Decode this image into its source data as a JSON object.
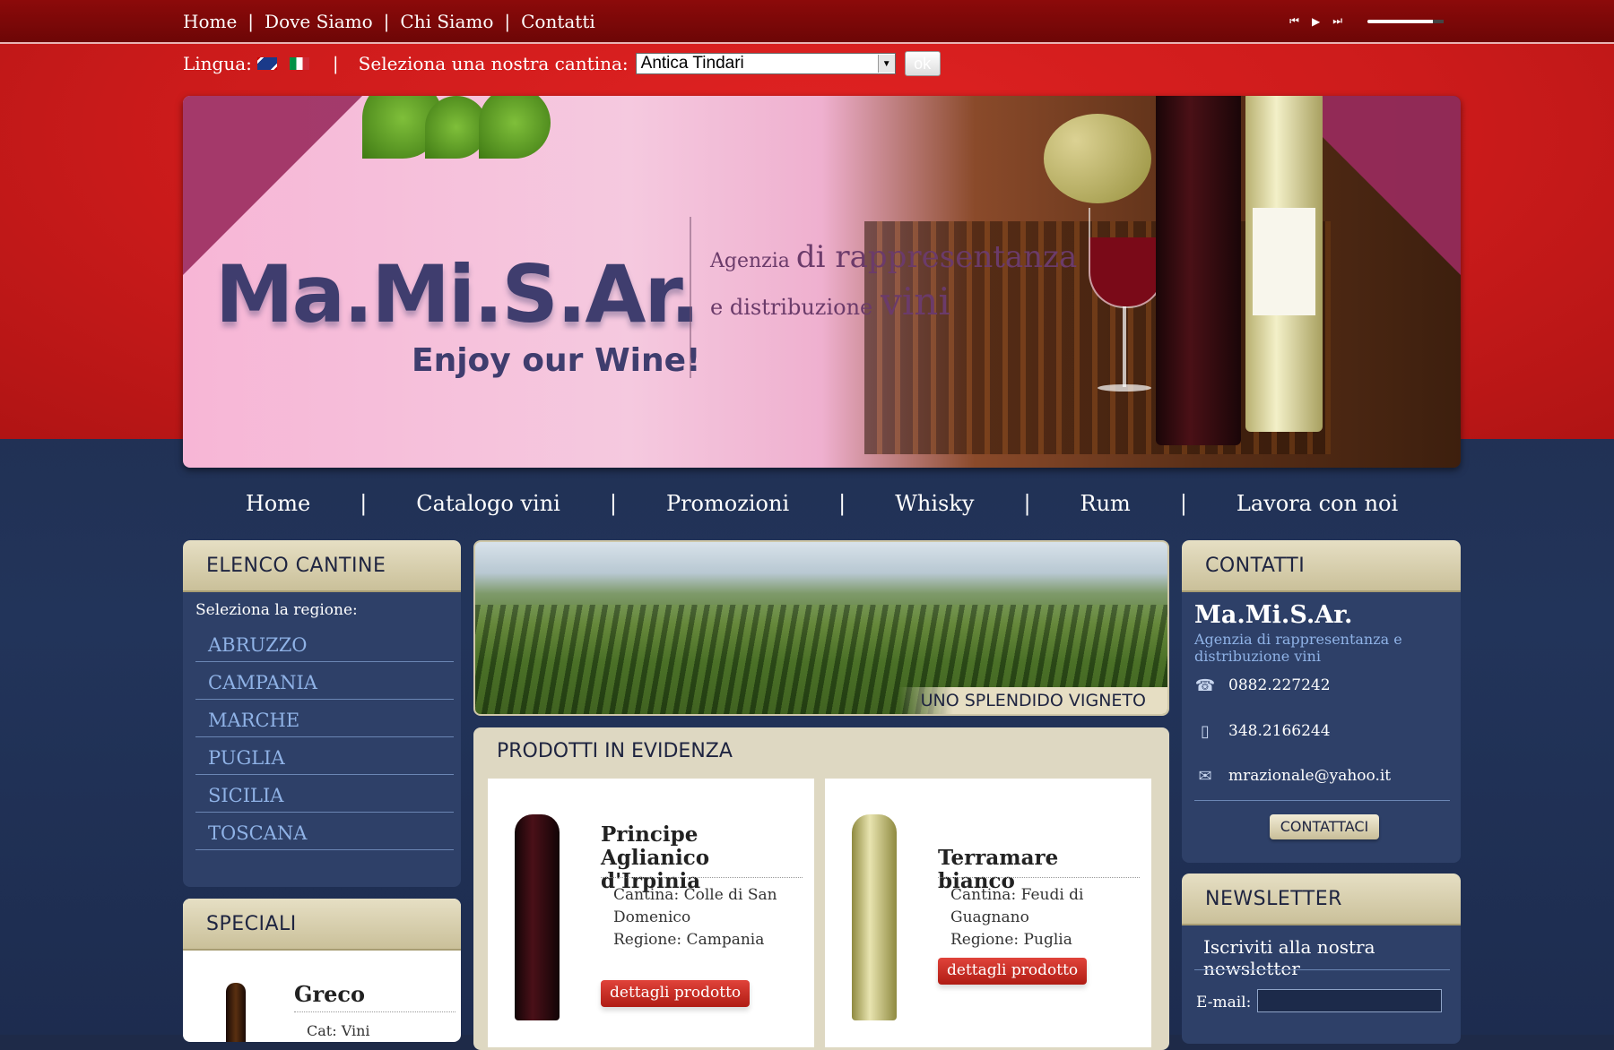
{
  "topnav": {
    "items": [
      "Home",
      "Dove Siamo",
      "Chi Siamo",
      "Contatti"
    ]
  },
  "lang": {
    "label": "Lingua:",
    "cantina_label": "Seleziona una nostra cantina:",
    "cantina_selected": "Antica Tindari",
    "ok_label": "ok"
  },
  "banner": {
    "logo": "Ma.Mi.S.Ar.",
    "slogan": "Enjoy our Wine!",
    "tagline1_small": "Agenzia",
    "tagline1_big": "di rappresentanza",
    "tagline2_small": "e distribuzione",
    "tagline2_big": "vini"
  },
  "mainnav": {
    "items": [
      "Home",
      "Catalogo vini",
      "Promozioni",
      "Whisky",
      "Rum",
      "Lavora con noi"
    ]
  },
  "cantine": {
    "title": "ELENCO CANTINE",
    "hint": "Seleziona la regione:",
    "regions": [
      "ABRUZZO",
      "CAMPANIA",
      "MARCHE",
      "PUGLIA",
      "SICILIA",
      "TOSCANA"
    ]
  },
  "speciali": {
    "title": "SPECIALI",
    "item_name": "Greco",
    "item_meta": "Cat: Vini"
  },
  "vineyard": {
    "caption": "UNO SPLENDIDO VIGNETO"
  },
  "products": {
    "title": "PRODOTTI IN EVIDENZA",
    "items": [
      {
        "name": "Principe Aglianico d'Irpinia",
        "cantina": "Cantina: Colle di San Domenico",
        "regione": "Regione: Campania",
        "button": "dettagli prodotto"
      },
      {
        "name": "Terramare bianco",
        "cantina": "Cantina: Feudi di Guagnano",
        "regione": "Regione: Puglia",
        "button": "dettagli prodotto"
      }
    ]
  },
  "contatti": {
    "title": "CONTATTI",
    "name": "Ma.Mi.S.Ar.",
    "subtitle": "Agenzia di rappresentanza e distribuzione vini",
    "phone": "0882.227242",
    "mobile": "348.2166244",
    "email": "mrazionale@yahoo.it",
    "button": "CONTATTACI"
  },
  "newsletter": {
    "title": "NEWSLETTER",
    "text": "Iscriviti alla nostra newsletter",
    "email_label": "E-mail:"
  }
}
